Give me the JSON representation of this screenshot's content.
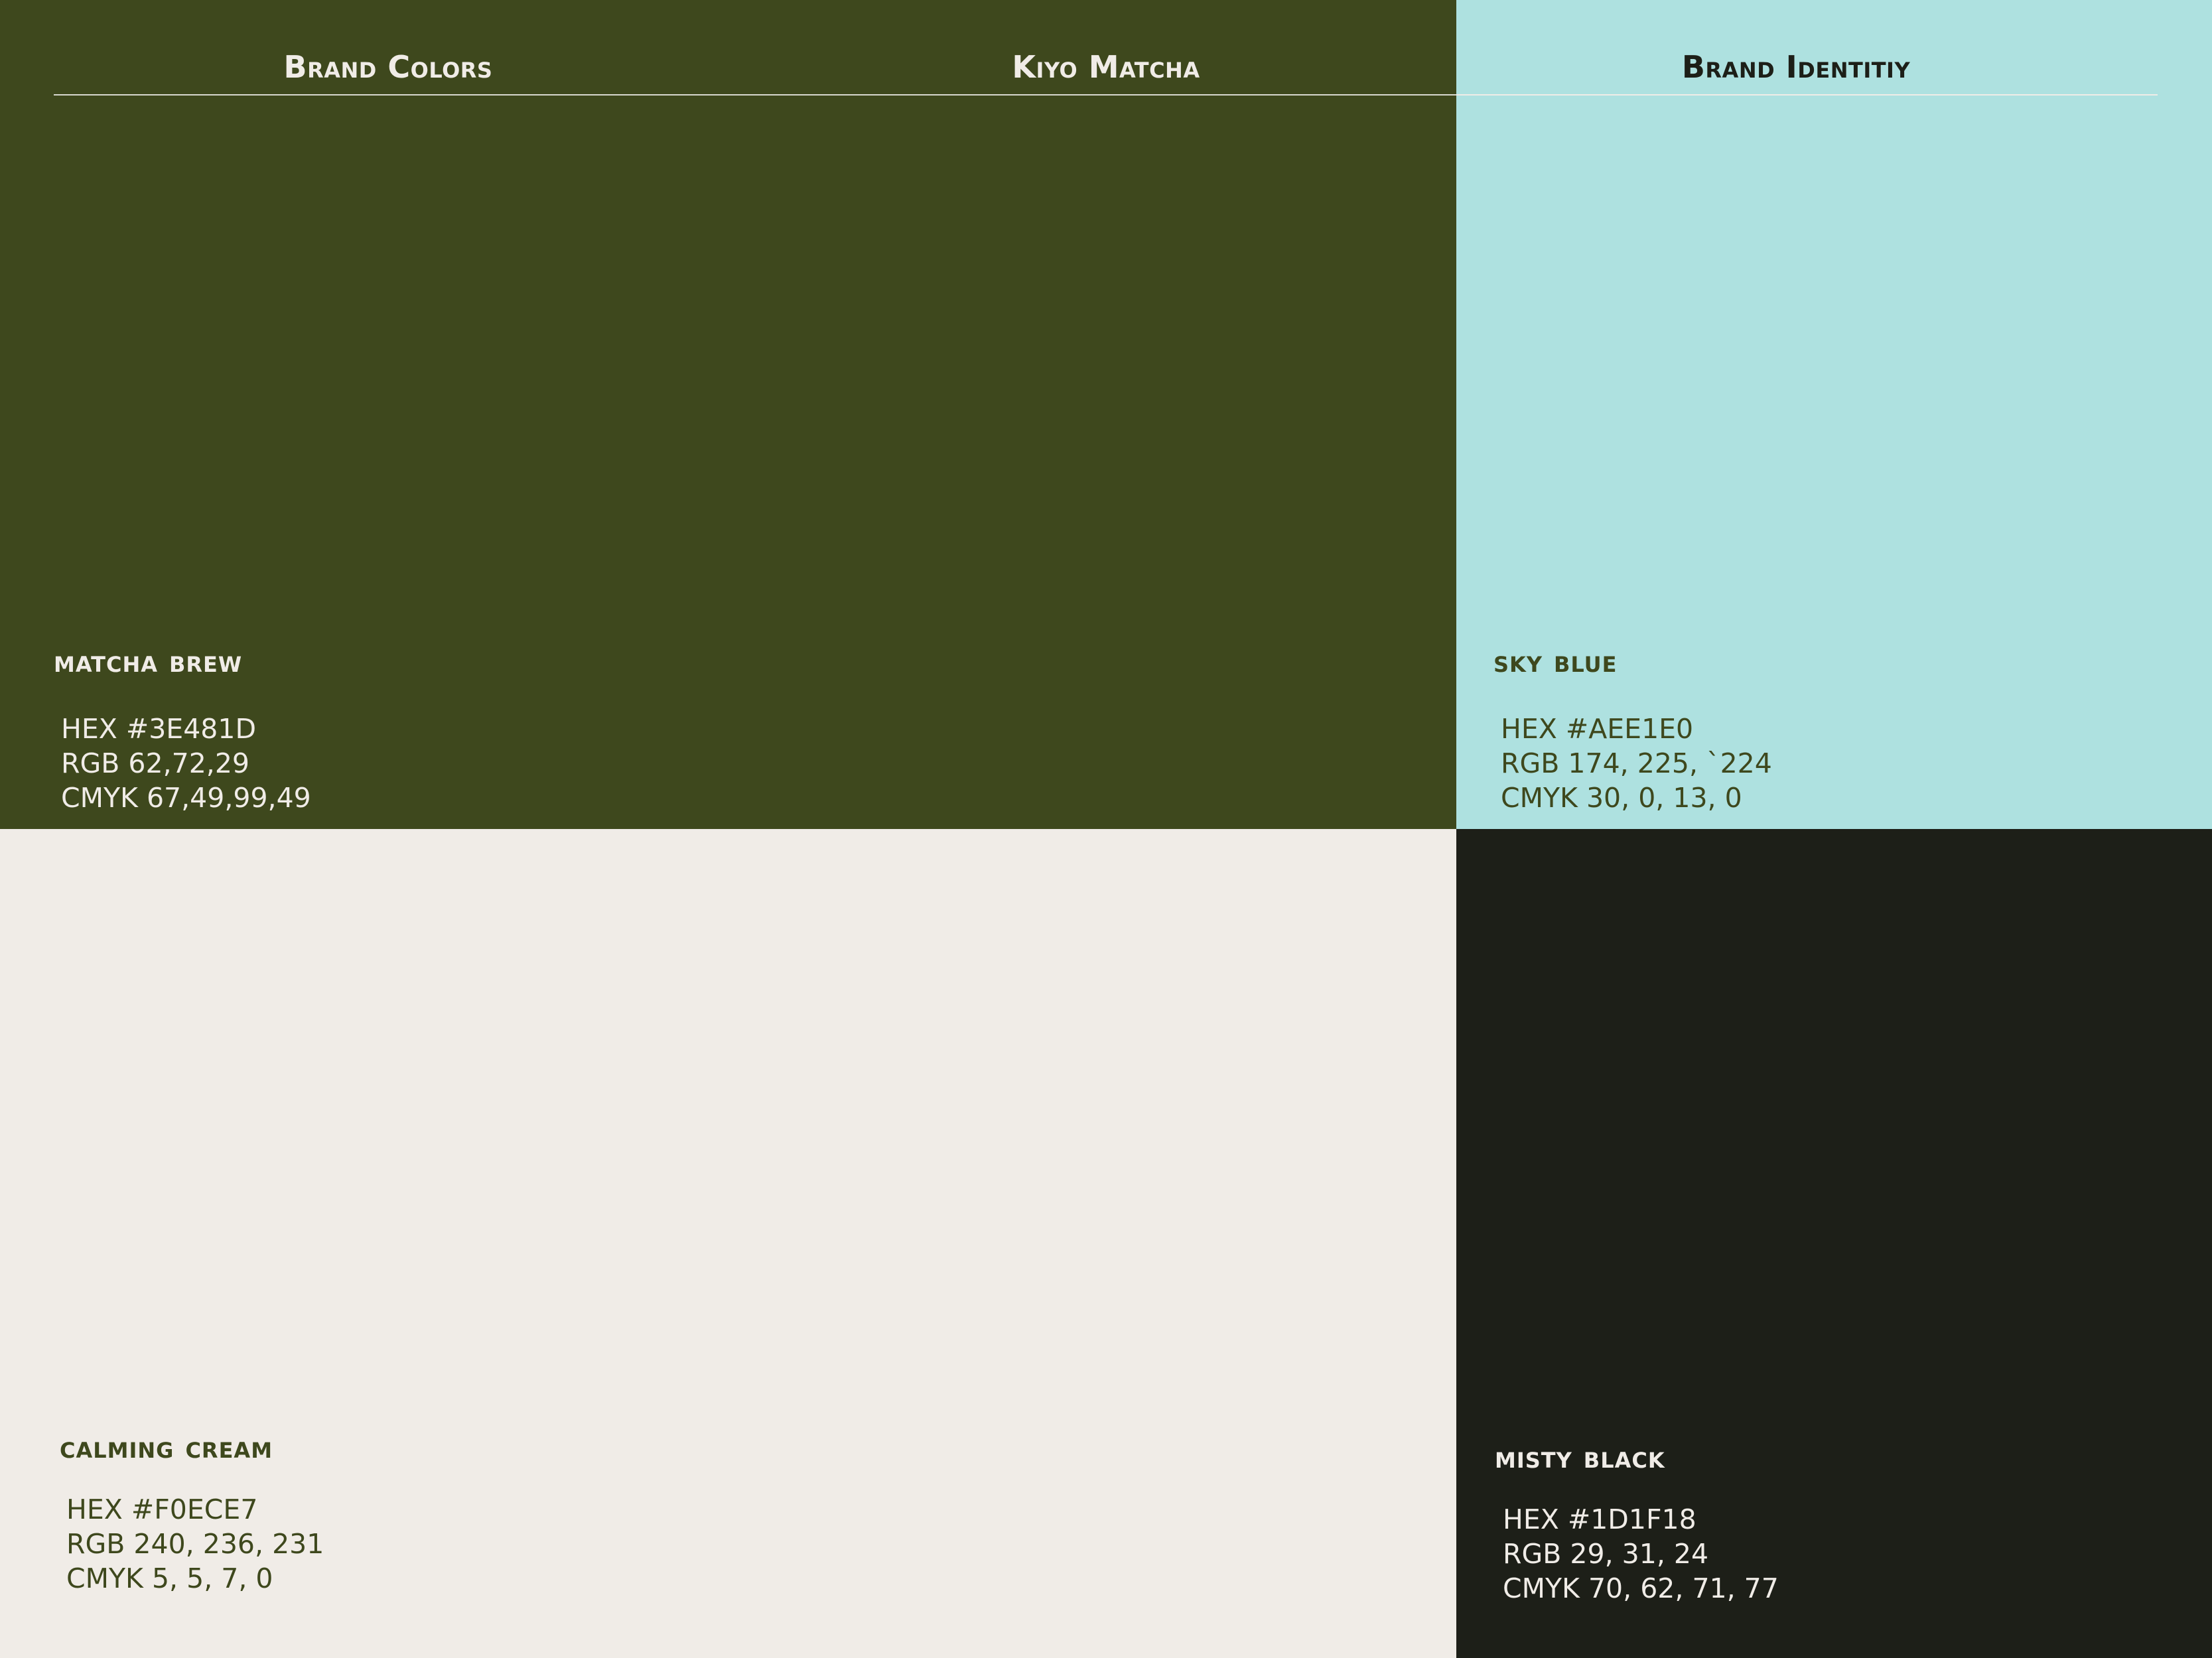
{
  "header": {
    "left_label": "Brand Colors",
    "center_label": "Kiyo Matcha",
    "right_label": "Brand Identitiy"
  },
  "swatches": {
    "matcha": {
      "name": "matcha brew",
      "hex": "HEX #3E481D",
      "rgb": "RGB 62,72,29",
      "cmyk": "CMYK 67,49,99,49",
      "color": "#3E481D",
      "text_color": "#F0ECE7"
    },
    "sky": {
      "name": "sky blue",
      "hex": "HEX #AEE1E0",
      "rgb": "RGB 174, 225, `224",
      "cmyk": "CMYK 30, 0, 13, 0",
      "color": "#AEE1E0",
      "text_color": "#3E481D"
    },
    "cream": {
      "name": "calming cream",
      "hex": "HEX #F0ECE7",
      "rgb": "RGB 240, 236, 231",
      "cmyk": "CMYK 5, 5, 7, 0",
      "color": "#F0ECE7",
      "text_color": "#3E481D"
    },
    "black": {
      "name": "misty black",
      "hex": "HEX #1D1F18",
      "rgb": "RGB 29, 31, 24",
      "cmyk": "CMYK 70, 62, 71, 77",
      "color": "#1D1F18",
      "text_color": "#F0ECE7"
    }
  }
}
